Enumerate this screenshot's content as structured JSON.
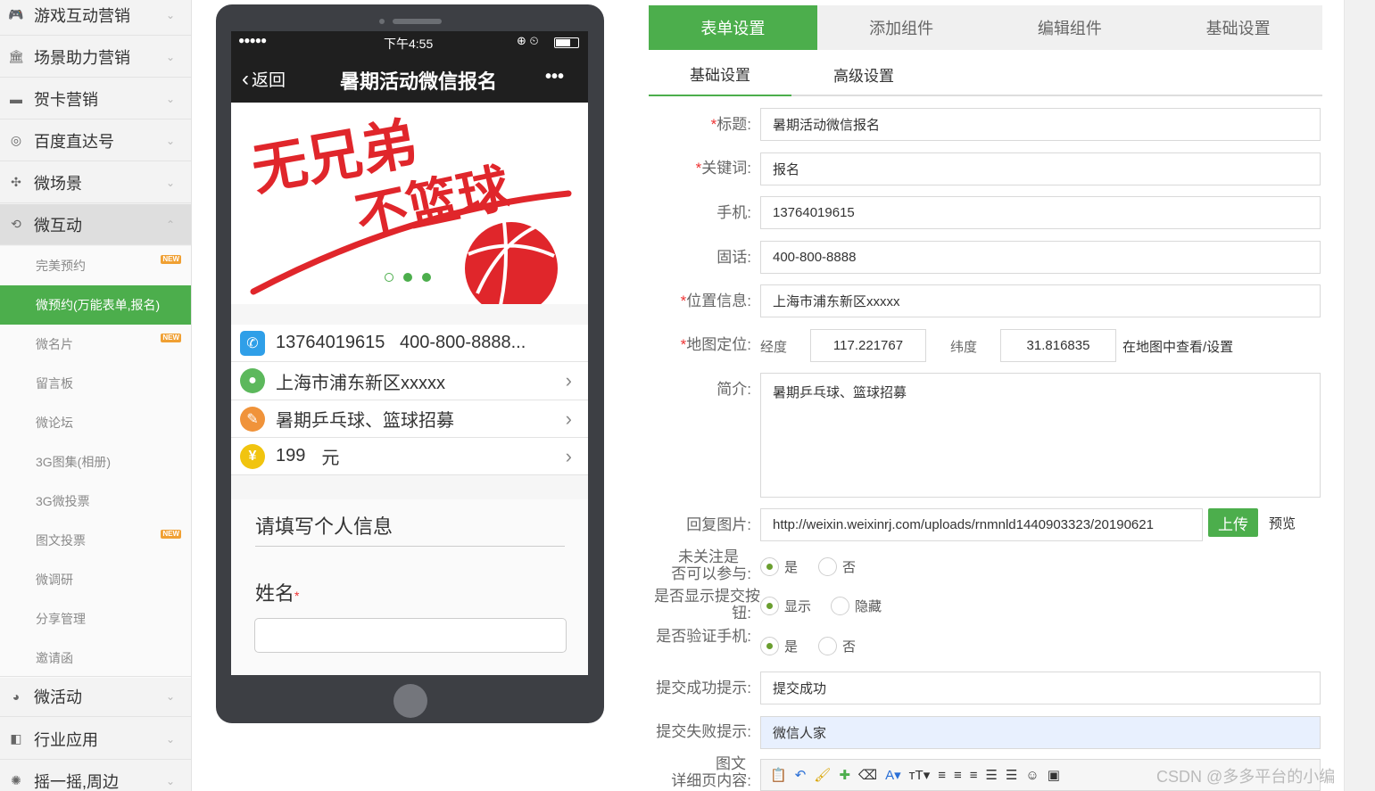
{
  "sidebar": {
    "menus_top": [
      {
        "label": "游戏互动营销",
        "icon": "gamepad-icon"
      },
      {
        "label": "场景助力营销",
        "icon": "bank-icon"
      },
      {
        "label": "贺卡营销",
        "icon": "card-icon"
      },
      {
        "label": "百度直达号",
        "icon": "baidu-icon"
      },
      {
        "label": "微场景",
        "icon": "scene-icon"
      },
      {
        "label": "微互动",
        "icon": "interact-icon"
      }
    ],
    "submenu": [
      {
        "label": "完美预约",
        "badge": "NEW"
      },
      {
        "label": "微预约(万能表单,报名)",
        "badge": ""
      },
      {
        "label": "微名片",
        "badge": "NEW"
      },
      {
        "label": "留言板",
        "badge": ""
      },
      {
        "label": "微论坛",
        "badge": ""
      },
      {
        "label": "3G图集(相册)",
        "badge": ""
      },
      {
        "label": "3G微投票",
        "badge": ""
      },
      {
        "label": "图文投票",
        "badge": "NEW"
      },
      {
        "label": "微调研",
        "badge": ""
      },
      {
        "label": "分享管理",
        "badge": ""
      },
      {
        "label": "邀请函",
        "badge": ""
      }
    ],
    "menus_bottom": [
      {
        "label": "微活动",
        "icon": "activity-icon"
      },
      {
        "label": "行业应用",
        "icon": "industry-icon"
      },
      {
        "label": "摇一摇,周边",
        "icon": "shake-icon"
      }
    ]
  },
  "phone": {
    "status_time": "下午4:55",
    "back_label": "返回",
    "nav_title": "暑期活动微信报名",
    "more": "•••",
    "banner_text_1": "无兄弟",
    "banner_text_2": "不篮球",
    "phone_line": "13764019615   400-800-8888...",
    "address": "上海市浦东新区xxxxx",
    "intro": "暑期乒乓球、篮球招募",
    "price": "199",
    "price_unit": "元",
    "form_title": "请填写个人信息",
    "name_label": "姓名"
  },
  "tabs": {
    "top": [
      "表单设置",
      "添加组件",
      "编辑组件",
      "基础设置"
    ],
    "sub": [
      "基础设置",
      "高级设置"
    ]
  },
  "form": {
    "title_label": "标题:",
    "title_value": "暑期活动微信报名",
    "keyword_label": "关键词:",
    "keyword_value": "报名",
    "mobile_label": "手机:",
    "mobile_value": "13764019615",
    "tel_label": "固话:",
    "tel_value": "400-800-8888",
    "location_label": "位置信息:",
    "location_value": "上海市浦东新区xxxxx",
    "map_label": "地图定位:",
    "lng_label": "经度",
    "lng_value": "117.221767",
    "lat_label": "纬度",
    "lat_value": "31.816835",
    "map_link": "在地图中查看/设置",
    "intro_label": "简介:",
    "intro_value": "暑期乒乓球、篮球招募",
    "reply_img_label": "回复图片:",
    "reply_img_value": "http://weixin.weixinrj.com/uploads/rnmnld1440903323/20190621",
    "upload_label": "上传",
    "preview_label": "预览",
    "follow_label_1": "未关注是",
    "follow_label_2": "否可以参与:",
    "yes": "是",
    "no": "否",
    "show_submit_label_1": "是否显示提交按",
    "show_submit_label_2": "钮:",
    "show": "显示",
    "hide": "隐藏",
    "verify_label": "是否验证手机:",
    "success_label": "提交成功提示:",
    "success_value": "提交成功",
    "fail_label": "提交失败提示:",
    "fail_value": "微信人家",
    "detail_label_1": "图文",
    "detail_label_2": "详细页内容:"
  },
  "watermark": "CSDN @多多平台的小编",
  "colors": {
    "accent": "#4cae4c",
    "badge": "#f0a033",
    "banner_red": "#e0262b"
  }
}
